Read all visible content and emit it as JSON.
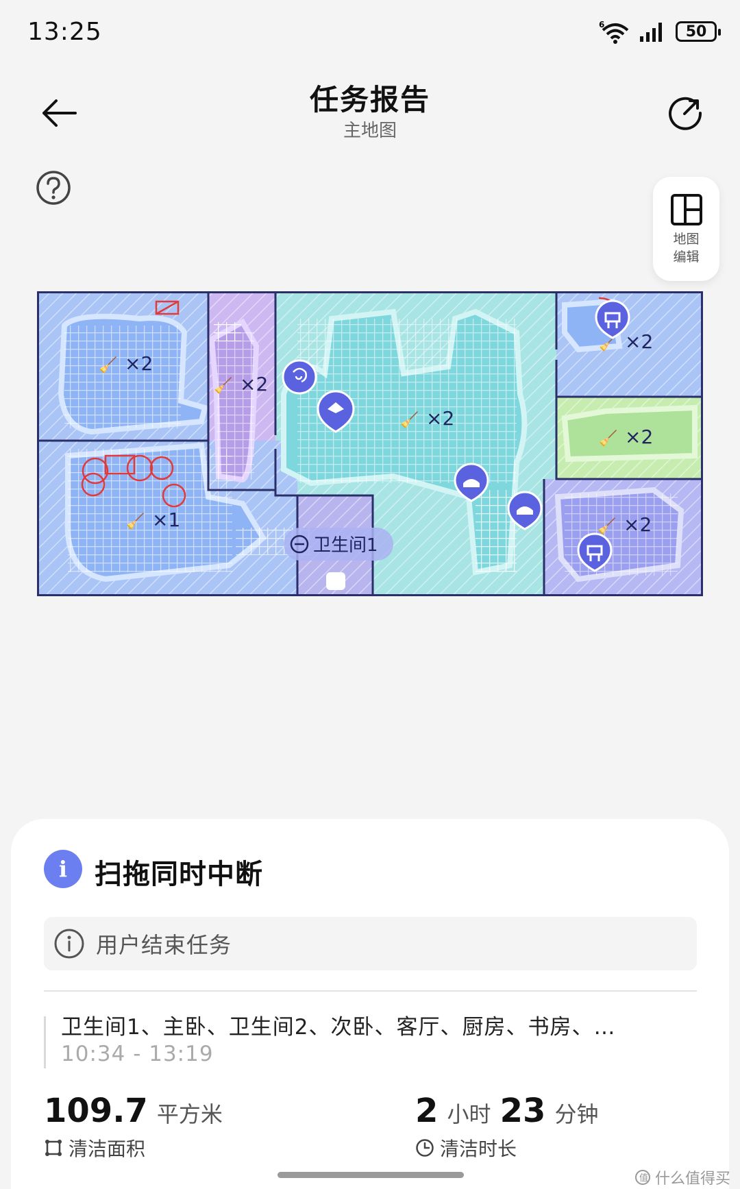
{
  "status_bar": {
    "time": "13:25",
    "battery": "50",
    "wifi_label": "6"
  },
  "header": {
    "title": "任务报告",
    "subtitle": "主地图"
  },
  "map_edit": {
    "label": "地图编辑"
  },
  "map": {
    "rooms": [
      {
        "id": "room-a",
        "passes": "×2",
        "color": "#aac4f6"
      },
      {
        "id": "room-b",
        "passes": "×2",
        "color": "#cdb8f2"
      },
      {
        "id": "room-c",
        "passes": "×2",
        "color": "#a8e4e4"
      },
      {
        "id": "room-d",
        "passes": "×2",
        "color": "#aac4f6"
      },
      {
        "id": "room-e",
        "passes": "×2",
        "color": "#c7ecb0"
      },
      {
        "id": "room-f",
        "passes": "×2",
        "color": "#b6b8f4"
      },
      {
        "id": "room-g",
        "passes": "×1",
        "color": "#aac4f6"
      },
      {
        "id": "room-h",
        "label": "卫生间1"
      }
    ]
  },
  "report": {
    "title": "扫拖同时中断",
    "reason": "用户结束任务",
    "rooms": "卫生间1、主卧、卫生间2、次卧、客厅、厨房、书房、…",
    "time_range": "10:34 - 13:19",
    "area": {
      "value": "109.7",
      "unit": "平方米",
      "label": "清洁面积"
    },
    "duration": {
      "hours": "2",
      "hours_unit": "小时",
      "minutes": "23",
      "minutes_unit": "分钟",
      "label": "清洁时长"
    }
  },
  "watermark": "什么值得买",
  "colors": {
    "accent": "#6b7ff0",
    "wall": "#2a2f6a",
    "red_mark": "#e03a3a"
  }
}
